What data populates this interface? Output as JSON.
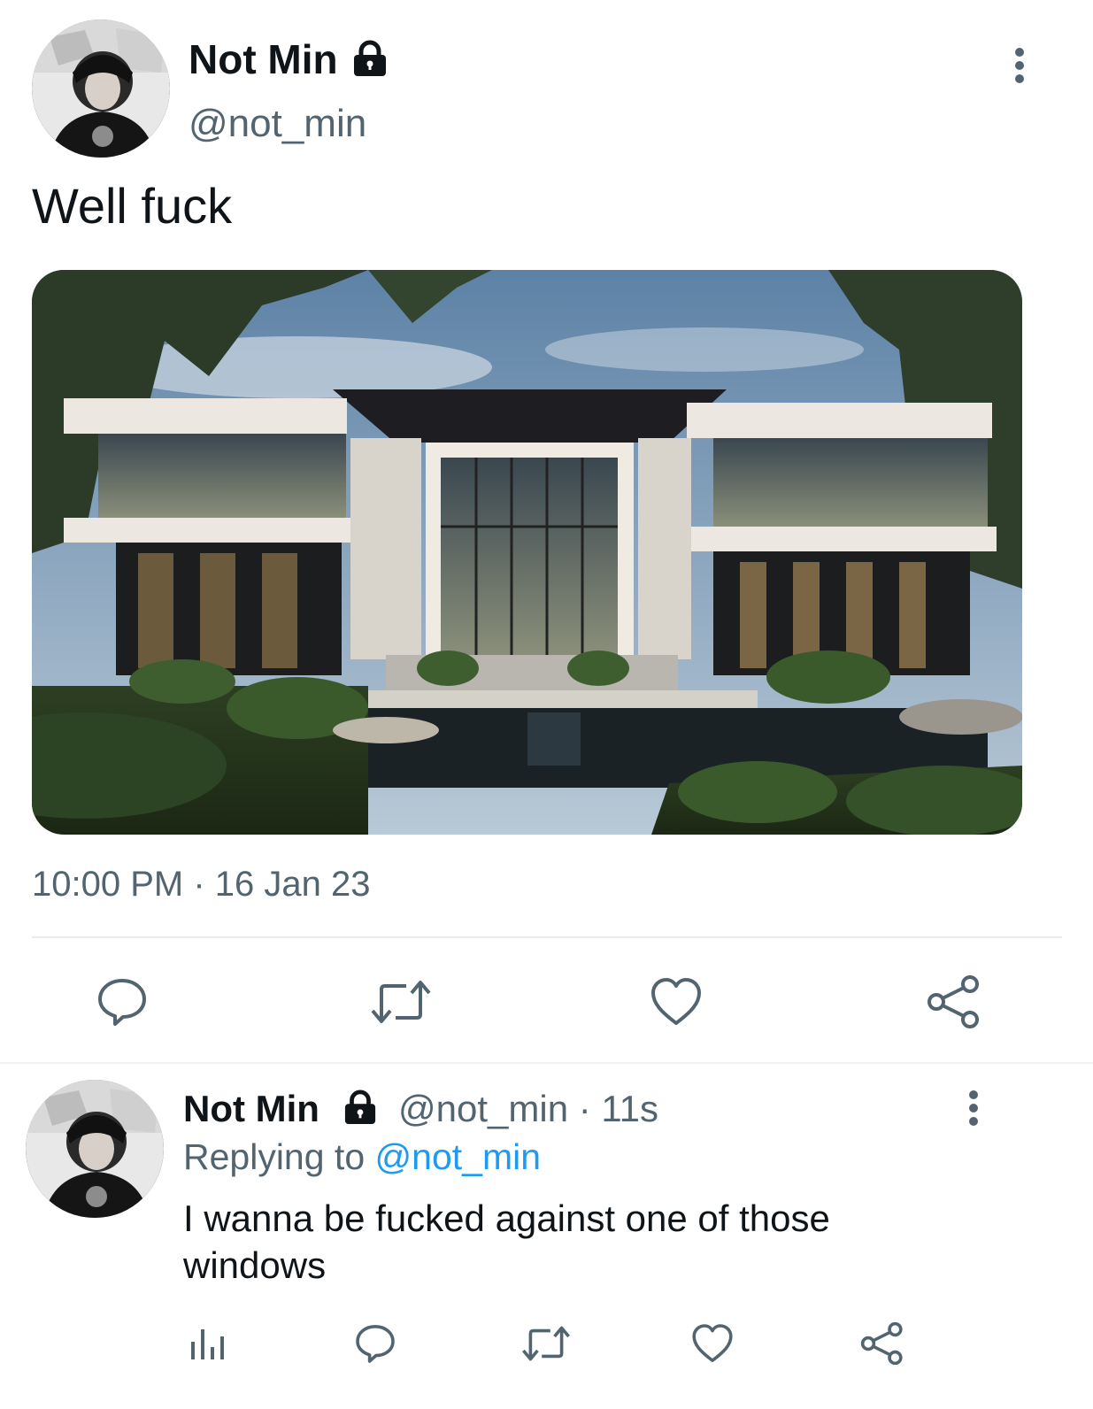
{
  "tweet": {
    "author_name": "Not Min",
    "author_handle": "@not_min",
    "text": "Well fuck",
    "time": "10:00 PM",
    "dot": "·",
    "date": "16 Jan 23",
    "media_alt": "modern luxury house with pool"
  },
  "reply": {
    "author_name": "Not Min",
    "author_handle": "@not_min",
    "dot": "·",
    "age": "11s",
    "replying_prefix": "Replying to",
    "replying_mention": "@not_min",
    "text": "I wanna be fucked against one of those windows"
  },
  "icons": {
    "lock": "lock-icon",
    "more": "more-vertical-icon",
    "reply": "reply-icon",
    "retweet": "retweet-icon",
    "like": "heart-icon",
    "share": "share-icon",
    "analytics": "analytics-icon"
  },
  "colors": {
    "text": "#0f1419",
    "secondary": "#536471",
    "link": "#1d9bf0",
    "icon": "#536471",
    "divider": "#e6ecf0"
  }
}
